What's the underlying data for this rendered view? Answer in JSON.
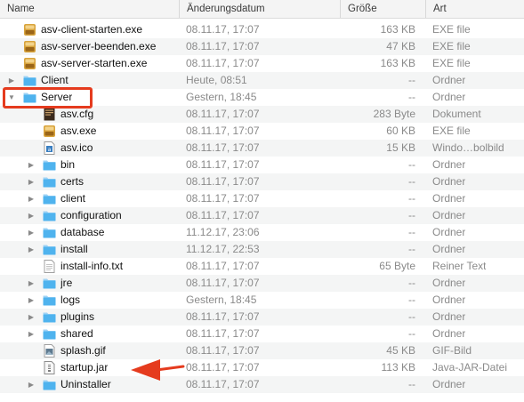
{
  "header": {
    "name": "Name",
    "date": "Änderungsdatum",
    "size": "Größe",
    "kind": "Art"
  },
  "rows": [
    {
      "name": "asv-client-starten.exe",
      "date": "08.11.17, 17:07",
      "size": "163 KB",
      "kind": "EXE file",
      "icon": "exe-icon",
      "level": 1,
      "folder": false
    },
    {
      "name": "asv-server-beenden.exe",
      "date": "08.11.17, 17:07",
      "size": "47 KB",
      "kind": "EXE file",
      "icon": "exe-icon",
      "level": 1,
      "folder": false
    },
    {
      "name": "asv-server-starten.exe",
      "date": "08.11.17, 17:07",
      "size": "163 KB",
      "kind": "EXE file",
      "icon": "exe-icon",
      "level": 1,
      "folder": false
    },
    {
      "name": "Client",
      "date": "Heute, 08:51",
      "size": "--",
      "kind": "Ordner",
      "icon": "folder-icon",
      "level": 0,
      "folder": true,
      "expanded": false
    },
    {
      "name": "Server",
      "date": "Gestern, 18:45",
      "size": "--",
      "kind": "Ordner",
      "icon": "folder-icon",
      "level": 0,
      "folder": true,
      "expanded": true
    },
    {
      "name": "asv.cfg",
      "date": "08.11.17, 17:07",
      "size": "283 Byte",
      "kind": "Dokument",
      "icon": "cfg-file-icon",
      "level": 1,
      "folder": false
    },
    {
      "name": "asv.exe",
      "date": "08.11.17, 17:07",
      "size": "60 KB",
      "kind": "EXE file",
      "icon": "exe-icon",
      "level": 1,
      "folder": false
    },
    {
      "name": "asv.ico",
      "date": "08.11.17, 17:07",
      "size": "15 KB",
      "kind": "Windo…bolbild",
      "icon": "ico-file-icon",
      "level": 1,
      "folder": false
    },
    {
      "name": "bin",
      "date": "08.11.17, 17:07",
      "size": "--",
      "kind": "Ordner",
      "icon": "folder-icon",
      "level": 1,
      "folder": true,
      "expanded": false
    },
    {
      "name": "certs",
      "date": "08.11.17, 17:07",
      "size": "--",
      "kind": "Ordner",
      "icon": "folder-icon",
      "level": 1,
      "folder": true,
      "expanded": false
    },
    {
      "name": "client",
      "date": "08.11.17, 17:07",
      "size": "--",
      "kind": "Ordner",
      "icon": "folder-icon",
      "level": 1,
      "folder": true,
      "expanded": false
    },
    {
      "name": "configuration",
      "date": "08.11.17, 17:07",
      "size": "--",
      "kind": "Ordner",
      "icon": "folder-icon",
      "level": 1,
      "folder": true,
      "expanded": false
    },
    {
      "name": "database",
      "date": "11.12.17, 23:06",
      "size": "--",
      "kind": "Ordner",
      "icon": "folder-icon",
      "level": 1,
      "folder": true,
      "expanded": false
    },
    {
      "name": "install",
      "date": "11.12.17, 22:53",
      "size": "--",
      "kind": "Ordner",
      "icon": "folder-icon",
      "level": 1,
      "folder": true,
      "expanded": false
    },
    {
      "name": "install-info.txt",
      "date": "08.11.17, 17:07",
      "size": "65 Byte",
      "kind": "Reiner Text",
      "icon": "text-file-icon",
      "level": 1,
      "folder": false
    },
    {
      "name": "jre",
      "date": "08.11.17, 17:07",
      "size": "--",
      "kind": "Ordner",
      "icon": "folder-icon",
      "level": 1,
      "folder": true,
      "expanded": false
    },
    {
      "name": "logs",
      "date": "Gestern, 18:45",
      "size": "--",
      "kind": "Ordner",
      "icon": "folder-icon",
      "level": 1,
      "folder": true,
      "expanded": false
    },
    {
      "name": "plugins",
      "date": "08.11.17, 17:07",
      "size": "--",
      "kind": "Ordner",
      "icon": "folder-icon",
      "level": 1,
      "folder": true,
      "expanded": false
    },
    {
      "name": "shared",
      "date": "08.11.17, 17:07",
      "size": "--",
      "kind": "Ordner",
      "icon": "folder-icon",
      "level": 1,
      "folder": true,
      "expanded": false
    },
    {
      "name": "splash.gif",
      "date": "08.11.17, 17:07",
      "size": "45 KB",
      "kind": "GIF-Bild",
      "icon": "image-file-icon",
      "level": 1,
      "folder": false
    },
    {
      "name": "startup.jar",
      "date": "08.11.17, 17:07",
      "size": "113 KB",
      "kind": "Java-JAR-Datei",
      "icon": "jar-file-icon",
      "level": 1,
      "folder": false
    },
    {
      "name": "Uninstaller",
      "date": "08.11.17, 17:07",
      "size": "--",
      "kind": "Ordner",
      "icon": "folder-icon",
      "level": 1,
      "folder": true,
      "expanded": false
    }
  ],
  "annotations": {
    "highlight_color": "#e53b1e",
    "highlighted_row": "Server",
    "arrow_target_row": "startup.jar"
  },
  "colors": {
    "folder": "#4fb3ee",
    "exe_icon": "#d8a33c",
    "secondary_text": "#8a8a8a"
  }
}
